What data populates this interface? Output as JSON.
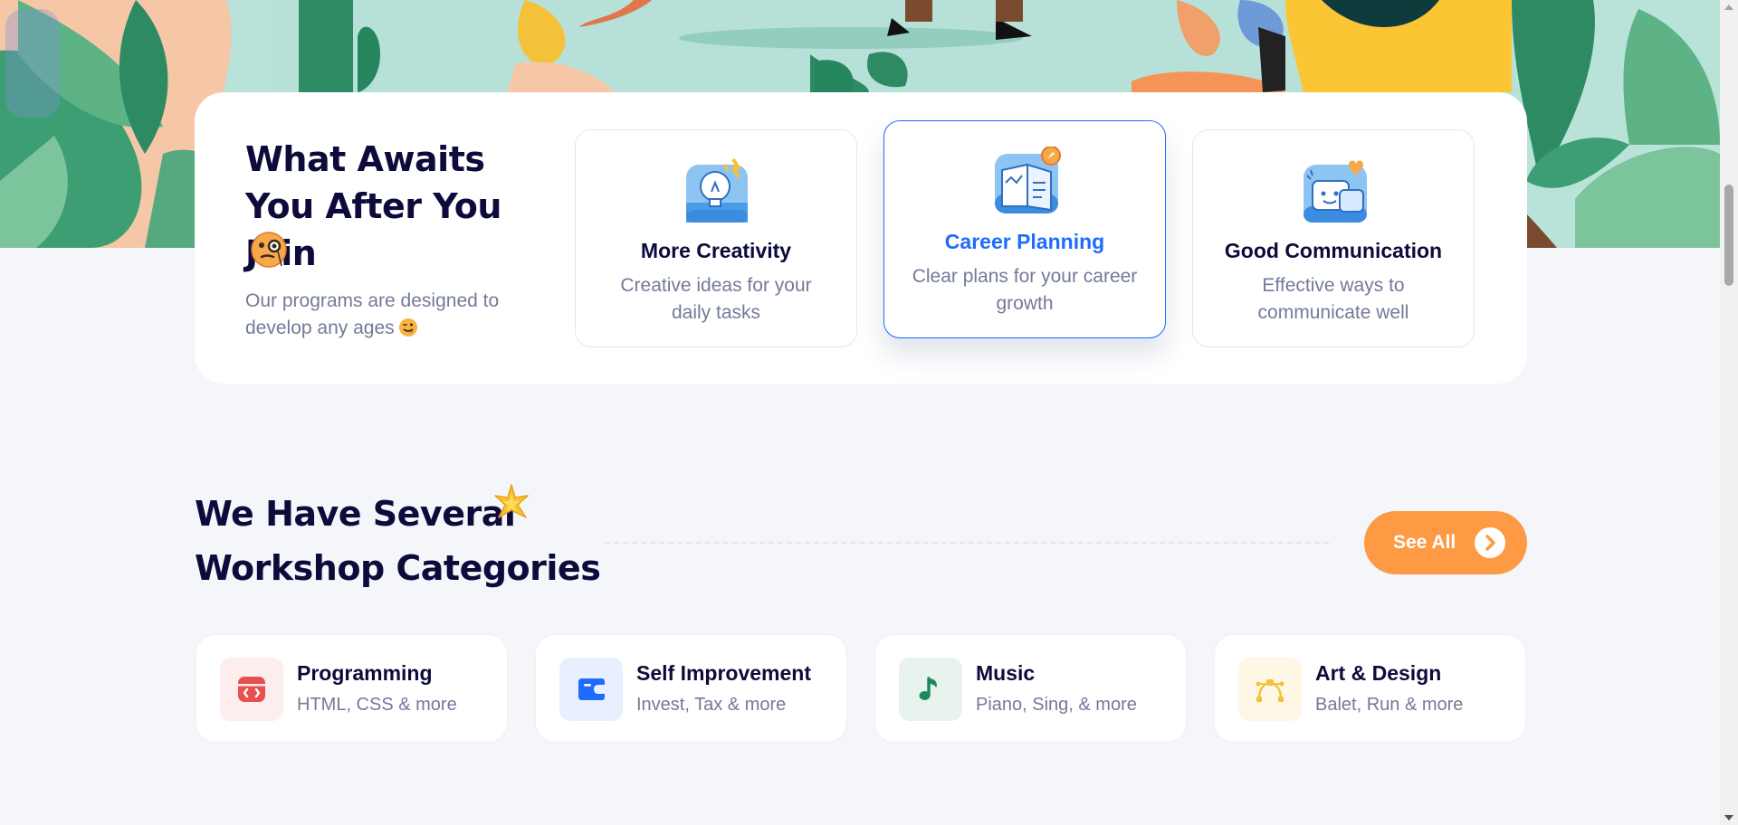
{
  "awaits": {
    "title": "What Awaits You After You Join",
    "description": "Our programs are designed to develop any ages",
    "features": [
      {
        "title": "More Creativity",
        "description": "Creative ideas for your daily tasks",
        "icon": "lightbulb-icon"
      },
      {
        "title": "Career Planning",
        "description": "Clear plans for your career growth",
        "icon": "map-compass-icon",
        "active": true
      },
      {
        "title": "Good Communication",
        "description": "Effective ways to communicate well",
        "icon": "chat-bubble-icon"
      }
    ]
  },
  "workshops": {
    "title": "We Have Several Workshop Categories",
    "see_all_label": "See All",
    "categories": [
      {
        "name": "Programming",
        "subtitle": "HTML, CSS & more",
        "icon": "code-window-icon",
        "color": "#E8504F",
        "bg": "#FDEEEE"
      },
      {
        "name": "Self Improvement",
        "subtitle": "Invest, Tax & more",
        "icon": "wallet-icon",
        "color": "#1E6BFF",
        "bg": "#E8F0FF"
      },
      {
        "name": "Music",
        "subtitle": "Piano, Sing, & more",
        "icon": "music-note-icon",
        "color": "#1E8A5B",
        "bg": "#E8F3EE"
      },
      {
        "name": "Art & Design",
        "subtitle": "Balet, Run & more",
        "icon": "vector-pen-icon",
        "color": "#F4C23A",
        "bg": "#FEF7E6"
      }
    ]
  },
  "colors": {
    "accent_orange": "#FD9A43",
    "accent_blue": "#1E6BFF",
    "heading": "#0C0B3B",
    "muted": "#737A99",
    "page_bg": "#F5F6FA"
  }
}
